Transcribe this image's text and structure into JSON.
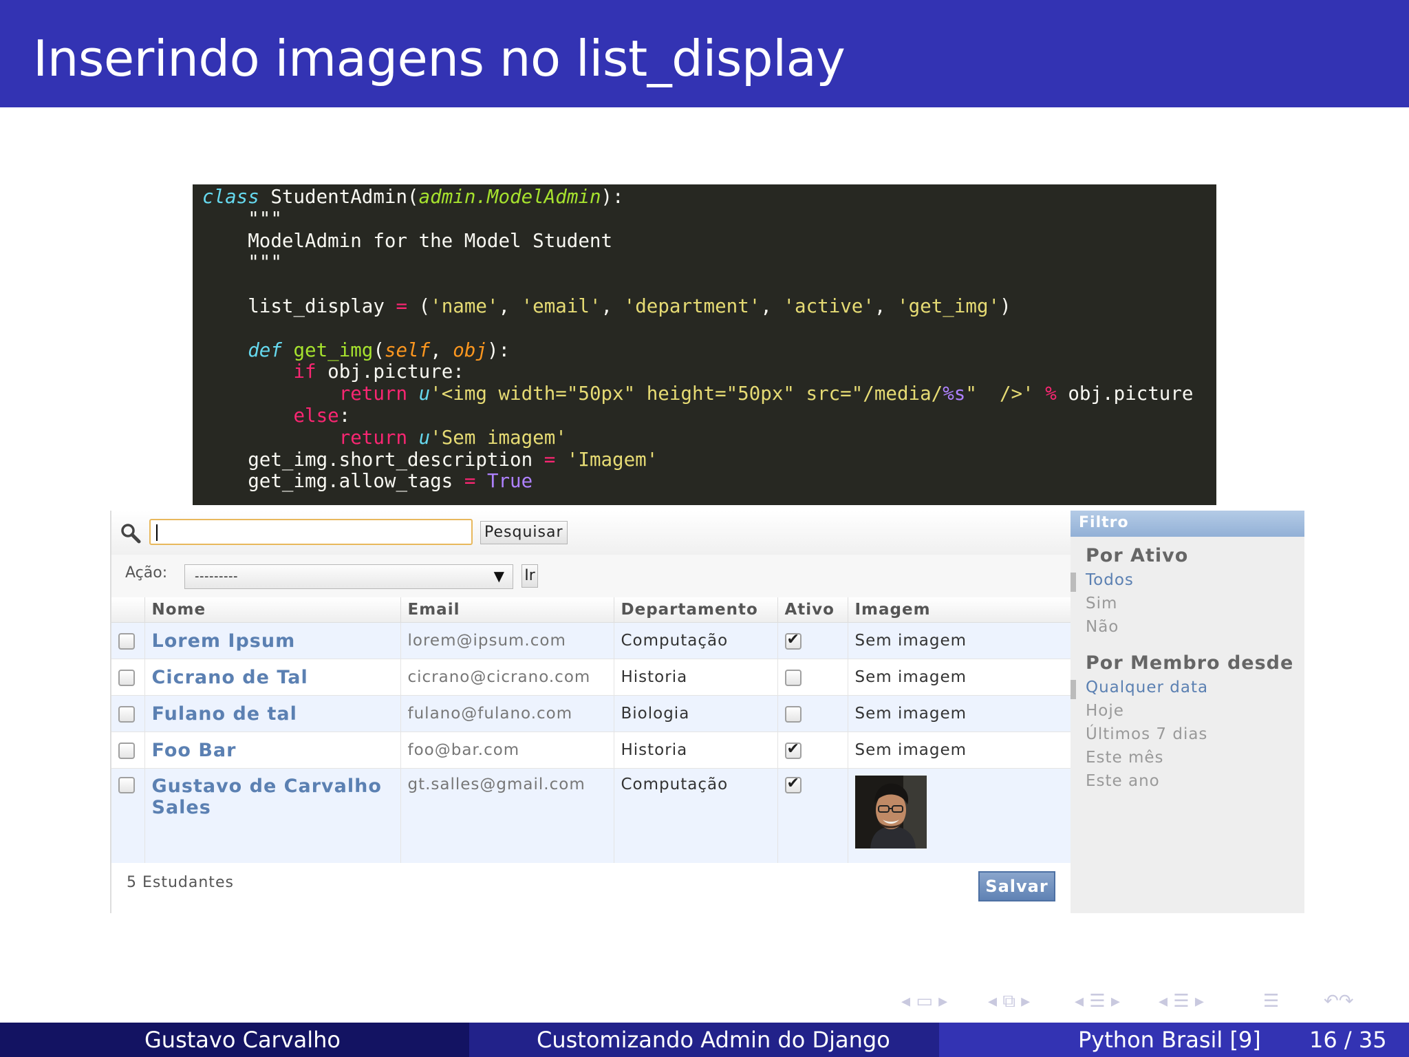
{
  "slide": {
    "title": "Inserindo imagens no list_display",
    "footer": {
      "author": "Gustavo Carvalho",
      "talk": "Customizando Admin do Django",
      "event": "Python Brasil [9]",
      "page": "16 / 35"
    }
  },
  "code": {
    "l1_class": "class",
    "l1_name": " StudentAdmin(",
    "l1_base": "admin.ModelAdmin",
    "l1_end": "):",
    "l2": "    \"\"\"",
    "l3": "    ModelAdmin for the Model Student",
    "l4": "    \"\"\"",
    "l6_a": "    list_display ",
    "l6_op": "=",
    "l6_b": " (",
    "l6_s1": "'name'",
    "l6_s2": "'email'",
    "l6_s3": "'department'",
    "l6_s4": "'active'",
    "l6_s5": "'get_img'",
    "l6_end": ")",
    "l8_def": "def",
    "l8_fn": "get_img",
    "l8_self": "self",
    "l8_obj": "obj",
    "l9_if": "if",
    "l9_rest": " obj.picture:",
    "l10_ret": "return",
    "l10_u": "u",
    "l10_s1": "'<img width=\"50px\" height=\"50px\" src=\"/media/",
    "l10_fmt": "%s",
    "l10_s2": "\"  />'",
    "l10_pct": "%",
    "l10_rest": " obj.picture",
    "l11_else": "else",
    "l12_ret": "return",
    "l12_u": "u",
    "l12_s": "'Sem imagem'",
    "l13_a": "    get_img.short_description ",
    "l13_op": "=",
    "l13_s": "'Imagem'",
    "l14_a": "    get_img.allow_tags ",
    "l14_op": "=",
    "l14_val": "True"
  },
  "admin": {
    "search": {
      "value": "",
      "button": "Pesquisar"
    },
    "actions": {
      "label": "Ação:",
      "selected": "---------",
      "go": "Ir"
    },
    "columns": [
      "Nome",
      "Email",
      "Departamento",
      "Ativo",
      "Imagem"
    ],
    "rows": [
      {
        "name": "Lorem Ipsum",
        "email": "lorem@ipsum.com",
        "department": "Computação",
        "active": true,
        "image": "Sem imagem"
      },
      {
        "name": "Cicrano de Tal",
        "email": "cicrano@cicrano.com",
        "department": "Historia",
        "active": false,
        "image": "Sem imagem"
      },
      {
        "name": "Fulano de tal",
        "email": "fulano@fulano.com",
        "department": "Biologia",
        "active": false,
        "image": "Sem imagem"
      },
      {
        "name": "Foo Bar",
        "email": "foo@bar.com",
        "department": "Historia",
        "active": true,
        "image": "Sem imagem"
      },
      {
        "name": "Gustavo de Carvalho Sales",
        "email": "gt.salles@gmail.com",
        "department": "Computação",
        "active": true,
        "image": ""
      }
    ],
    "count": "5 Estudantes",
    "save": "Salvar",
    "filter": {
      "heading": "Filtro",
      "groups": [
        {
          "title": "Por Ativo",
          "items": [
            "Todos",
            "Sim",
            "Não"
          ]
        },
        {
          "title": "Por Membro desde",
          "items": [
            "Qualquer data",
            "Hoje",
            "Últimos 7 dias",
            "Este mês",
            "Este ano"
          ]
        }
      ]
    }
  },
  "colors": {
    "header": "#3333b3",
    "link": "#5b80b2",
    "code_bg": "#272822"
  }
}
